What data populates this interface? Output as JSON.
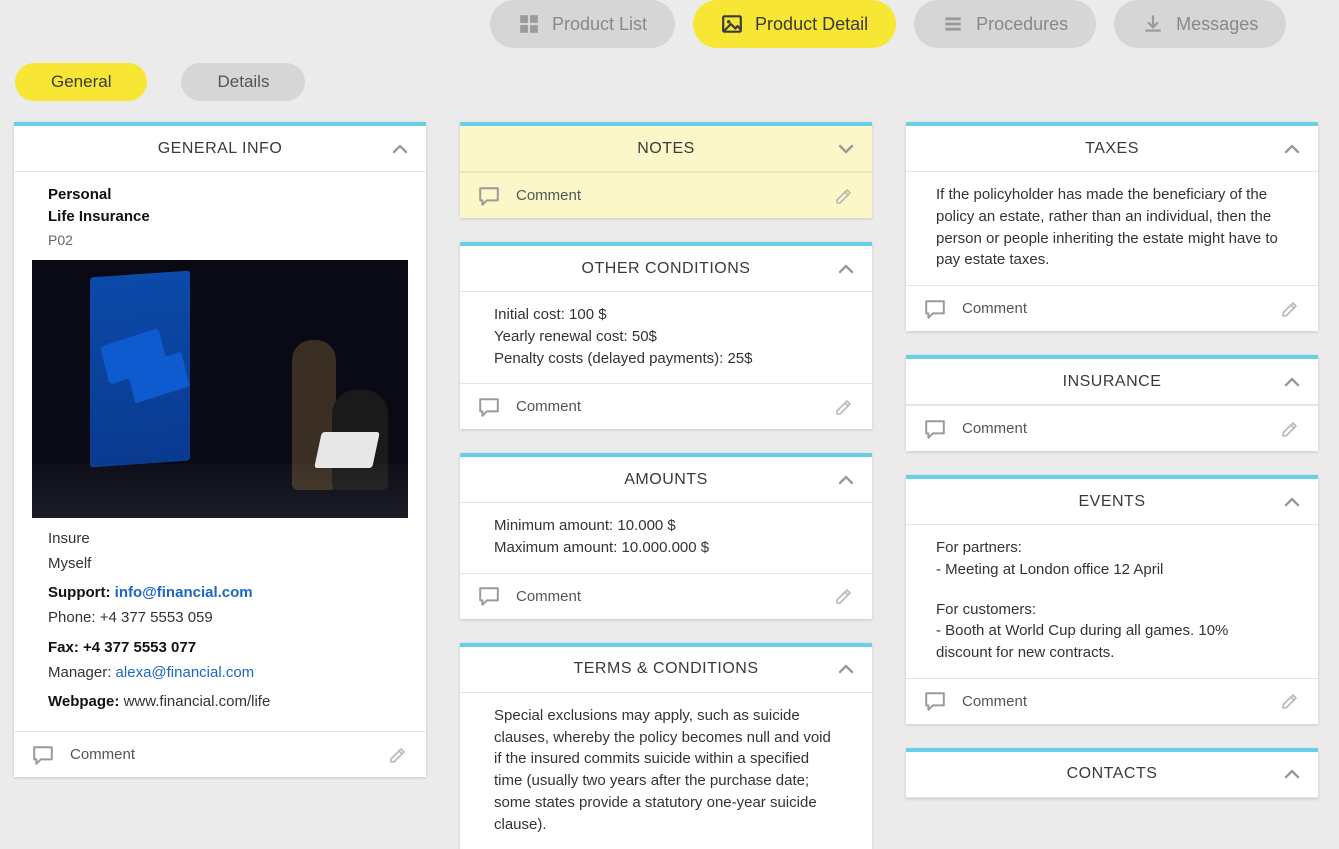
{
  "topTabs": {
    "productList": "Product List",
    "productDetail": "Product Detail",
    "procedures": "Procedures",
    "messages": "Messages"
  },
  "subTabs": {
    "general": "General",
    "details": "Details"
  },
  "generalInfo": {
    "header": "GENERAL INFO",
    "category": "Personal",
    "product": "Life Insurance",
    "code": "P02",
    "company1": "Insure",
    "company2": "Myself",
    "supportLabel": "Support:",
    "supportEmail": "info@financial.com",
    "phoneLabel": "Phone:",
    "phone": "+4 377 5553 059",
    "faxLabel": "Fax:",
    "fax": "+4 377 5553 077",
    "managerLabel": "Manager:",
    "managerEmail": "alexa@financial.com",
    "webpageLabel": "Webpage:",
    "webpage": "www.financial.com/life",
    "commentLabel": "Comment"
  },
  "notes": {
    "header": "NOTES",
    "commentLabel": "Comment"
  },
  "otherConditions": {
    "header": "OTHER CONDITIONS",
    "line1": "Initial cost: 100 $",
    "line2": "Yearly renewal cost: 50$",
    "line3": "Penalty costs (delayed payments): 25$",
    "commentLabel": "Comment"
  },
  "amounts": {
    "header": "AMOUNTS",
    "line1": "Minimum amount: 10.000 $",
    "line2": "Maximum amount: 10.000.000 $",
    "commentLabel": "Comment"
  },
  "terms": {
    "header": "TERMS & CONDITIONS",
    "body": "Special exclusions may apply, such as suicide clauses, whereby the policy becomes null and void if the insured commits suicide within a specified time (usually two years after the purchase date; some states provide a statutory one-year suicide clause)."
  },
  "taxes": {
    "header": "TAXES",
    "body": "If the policyholder has made the beneficiary of the policy an estate, rather than an individual, then the person or people inheriting the estate might have to pay estate taxes.",
    "commentLabel": "Comment"
  },
  "insurance": {
    "header": "INSURANCE",
    "commentLabel": "Comment"
  },
  "events": {
    "header": "EVENTS",
    "p1": "For partners:",
    "p1b": "- Meeting at London office 12 April",
    "p2": "For customers:",
    "p2b": "- Booth at World Cup during all games. 10% discount for new contracts.",
    "commentLabel": "Comment"
  },
  "contacts": {
    "header": "CONTACTS"
  }
}
